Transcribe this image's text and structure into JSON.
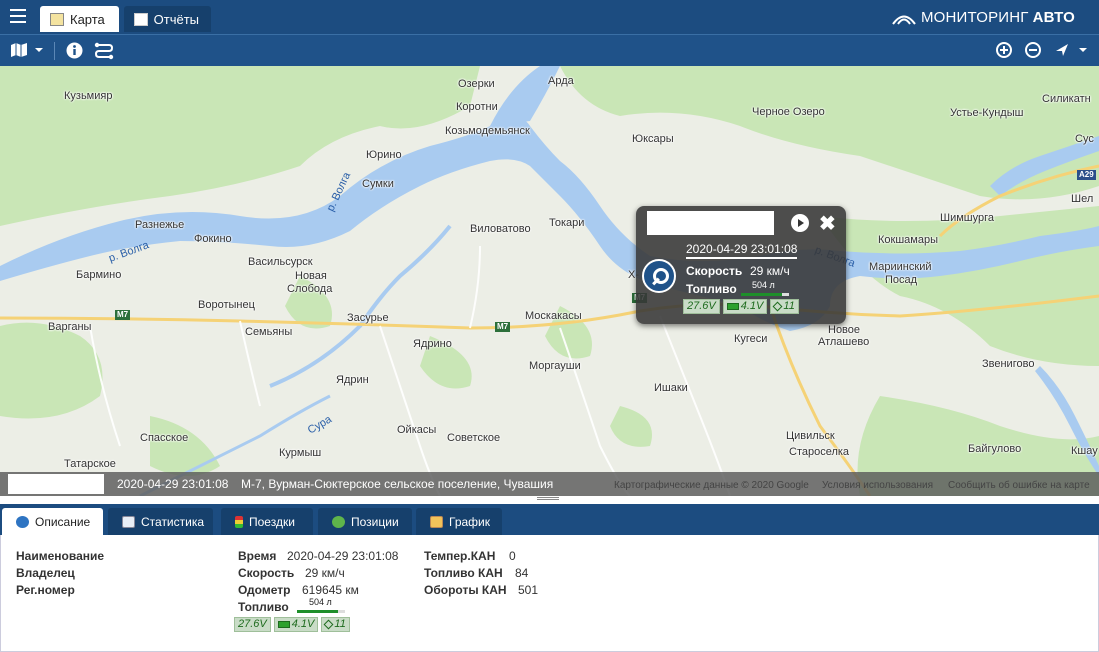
{
  "topbar": {
    "tabs": [
      {
        "label": "Карта",
        "icon": "map-tab-icon",
        "active": true
      },
      {
        "label": "Отчёты",
        "icon": "reports-tab-icon",
        "active": false
      }
    ],
    "brand_light": "МОНИТОРИНГ",
    "brand_bold": "АВТО"
  },
  "map": {
    "places": [
      "Кузьмияр",
      "Озерки",
      "Арда",
      "Коротни",
      "Козьмодемьянск",
      "Юксары",
      "Черное Озеро",
      "Устье-Кундыш",
      "Силикатн",
      "Сус",
      "Юрино",
      "Сумки",
      "Разнежье",
      "Фокино",
      "Виловатово",
      "Токари",
      "Шимшурга",
      "Кокшамары",
      "Шел",
      "Мариинский",
      "Посад",
      "Бармино",
      "Васильсурск",
      "Новая",
      "Слобода",
      "Воротынец",
      "Варганы",
      "Семьяны",
      "Засурье",
      "Москакасы",
      "Ядрино",
      "Моргауши",
      "Кугеси",
      "Новое",
      "Атлашево",
      "Звениговo",
      "Ишаки",
      "Ядрин",
      "Спасское",
      "Ойкасы",
      "Советское",
      "Цивильск",
      "Байгулово",
      "Кшау",
      "Татарское",
      "Курмыш",
      "Староселка",
      "Х-"
    ],
    "rivers": [
      "р. Волга",
      "р. Волга",
      "Сура",
      "р. Волга"
    ],
    "roads": [
      "M7",
      "M7",
      "M7",
      "A29"
    ],
    "status_time": "2020-04-29 23:01:08",
    "status_address": "М-7, Вурман-Сюктерское сельское поселение, Чувашия",
    "copyright": "Картографические данные © 2020 Google",
    "terms": "Условия использования",
    "report_error": "Сообщить об ошибке на карте"
  },
  "popup": {
    "time": "2020-04-29 23:01:08",
    "speed_label": "Скорость",
    "speed_value": "29 км/ч",
    "fuel_label": "Топливо",
    "fuel_value": "504 л",
    "fuel_level": 0.85,
    "voltage": "27.6V",
    "battery": "4.1V",
    "satellites": "11"
  },
  "bottom_tabs": [
    {
      "label": "Описание",
      "icon": "info-icon",
      "active": true
    },
    {
      "label": "Статистика",
      "icon": "stats-icon",
      "active": false
    },
    {
      "label": "Поездки",
      "icon": "trips-icon",
      "active": false
    },
    {
      "label": "Позиции",
      "icon": "positions-icon",
      "active": false
    },
    {
      "label": "График",
      "icon": "chart-icon",
      "active": false
    }
  ],
  "details": {
    "col1": {
      "name_label": "Наименование",
      "owner_label": "Владелец",
      "reg_label": "Рег.номер"
    },
    "col2": {
      "time_label": "Время",
      "time_value": "2020-04-29 23:01:08",
      "speed_label": "Скорость",
      "speed_value": "29 км/ч",
      "odometer_label": "Одометр",
      "odometer_value": "619645 км",
      "fuel_label": "Топливо",
      "fuel_value": "504 л",
      "fuel_level": 0.85,
      "voltage": "27.6V",
      "battery": "4.1V",
      "satellites": "11"
    },
    "col3": {
      "temp_label": "Темпер.КАН",
      "temp_value": "0",
      "fuel_can_label": "Топливо КАН",
      "fuel_can_value": "84",
      "rpm_label": "Обороты КАН",
      "rpm_value": "501"
    }
  },
  "colors": {
    "header": "#1c4c80",
    "toolbar": "#1f5289",
    "water": "#a9cbf0",
    "forest": "#c8e6b8",
    "fuel_bar": "#1e8f2a"
  }
}
